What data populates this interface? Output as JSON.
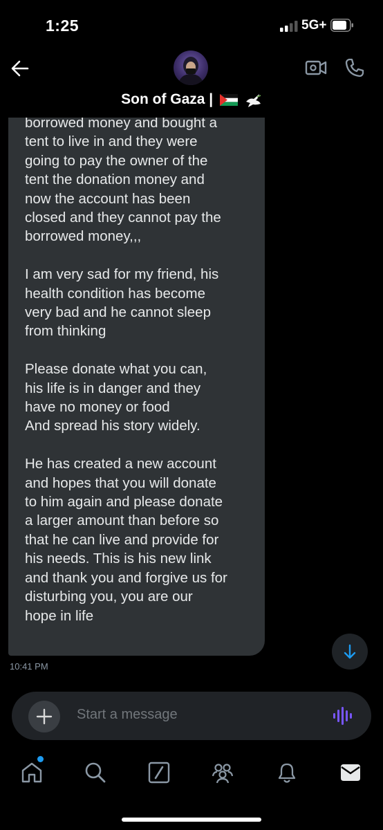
{
  "status": {
    "time": "1:25",
    "network": "5G+"
  },
  "header": {
    "title": "Son of Gaza |",
    "emoji": "🇵🇸🕊️"
  },
  "message": {
    "paragraphs": [
      "borrowed money and bought a\ntent to live in and they were\ngoing to pay the owner of the\ntent the donation money and\nnow the account has been\nclosed and they cannot pay the\nborrowed money,,,",
      "I am very sad for my friend, his\nhealth condition has become\nvery bad and he cannot sleep\nfrom thinking",
      "Please donate what you can,\nhis life is in danger and they\nhave no money or food\nAnd spread his story widely.",
      "He has created a new account\nand hopes that you will donate\nto him again and please donate\na larger amount than before so\nthat he can live and provide for\nhis needs. This is his new link\nand thank you and forgive us for\ndisturbing you, you are our\nhope in life"
    ],
    "timestamp": "10:41 PM"
  },
  "composer": {
    "placeholder": "Start a message"
  },
  "nav": {
    "items": [
      "home-icon",
      "search-icon",
      "grok-icon",
      "communities-icon",
      "notifications-icon",
      "messages-icon"
    ]
  },
  "colors": {
    "accent": "#1d9bf0",
    "bubble": "#2f3336",
    "voice": "#7856ff"
  }
}
